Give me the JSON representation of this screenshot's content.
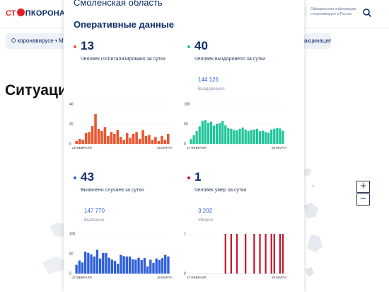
{
  "site": {
    "logo_prefix": "СТ",
    "logo_suffix": "ПКОРОНАВИ",
    "header_info": "Официальная информация о коронавирусе в России",
    "nav": [
      {
        "label": "О коронавирусе ▾"
      },
      {
        "label": "М"
      },
      {
        "label": "акцинация ▾"
      }
    ],
    "page_heading": "Ситуаци",
    "zoom_in": "+",
    "zoom_out": "−"
  },
  "panel": {
    "region": "Смоленская область",
    "section_title": "Оперативные данные",
    "stats": [
      {
        "id": "hospitalized",
        "value": "13",
        "desc": "Человек госпитализировано за сутки",
        "total": "",
        "total_label": "",
        "color": "#e8562f"
      },
      {
        "id": "recovered",
        "value": "40",
        "desc": "Человек выздоровело за сутки",
        "total": "144 126",
        "total_label": "Выздоровело",
        "color": "#1fc59a"
      },
      {
        "id": "cases",
        "value": "43",
        "desc": "Выявлено случаев за сутки",
        "total": "147 770",
        "total_label": "Выявлено",
        "color": "#2f5fd8"
      },
      {
        "id": "deaths",
        "value": "1",
        "desc": "Человек умер за сутки",
        "total": "3 202",
        "total_label": "Умерло",
        "color": "#c5162a"
      }
    ]
  },
  "chart_data": [
    {
      "type": "bar",
      "id": "hospitalized",
      "color": "#e8562f",
      "ylim": [
        0,
        40
      ],
      "yticks": [
        "40",
        "20",
        "0"
      ],
      "x_start": "26 ФЕВРАЛЯ",
      "x_end": "28 МАРТА",
      "values": [
        3,
        5,
        4,
        11,
        12,
        18,
        30,
        15,
        13,
        17,
        8,
        12,
        10,
        14,
        7,
        4,
        11,
        6,
        10,
        12,
        5,
        14,
        8,
        9,
        4,
        7,
        3,
        8,
        4,
        10
      ]
    },
    {
      "type": "bar",
      "id": "recovered",
      "color": "#1fc59a",
      "ylim": [
        0,
        100
      ],
      "yticks": [
        "100",
        "50",
        "0"
      ],
      "x_start": "27 ФЕВРАЛЯ",
      "x_end": "28 МАРТА",
      "values": [
        12,
        22,
        32,
        44,
        58,
        60,
        53,
        56,
        46,
        50,
        52,
        57,
        47,
        40,
        38,
        35,
        34,
        38,
        41,
        36,
        32,
        35,
        36,
        38,
        32,
        33,
        30,
        28,
        36,
        38,
        40,
        39,
        33
      ]
    },
    {
      "type": "bar",
      "id": "cases",
      "color": "#2f5fd8",
      "ylim": [
        0,
        100
      ],
      "yticks": [
        "100",
        "50",
        "0"
      ],
      "x_start": "27 ФЕВРАЛЯ",
      "x_end": "28 МАРТА",
      "values": [
        22,
        33,
        28,
        55,
        52,
        48,
        43,
        60,
        38,
        52,
        52,
        40,
        35,
        32,
        25,
        47,
        44,
        43,
        43,
        36,
        35,
        40,
        34,
        39,
        18,
        35,
        27,
        38,
        34,
        39,
        47,
        43
      ]
    },
    {
      "type": "bar",
      "id": "deaths",
      "color": "#c5162a",
      "ylim": [
        0,
        1
      ],
      "yticks": [
        "1",
        "0"
      ],
      "x_start": "27 ФЕВРАЛЯ",
      "x_end": "28 МАРТА",
      "values": [
        0,
        0,
        0,
        0,
        0,
        0,
        0,
        0,
        0,
        0,
        0,
        0,
        1,
        0,
        1,
        0,
        1,
        0,
        0,
        1,
        0,
        0,
        1,
        0,
        1,
        0,
        1,
        0,
        1,
        1,
        0,
        1,
        1
      ]
    }
  ]
}
